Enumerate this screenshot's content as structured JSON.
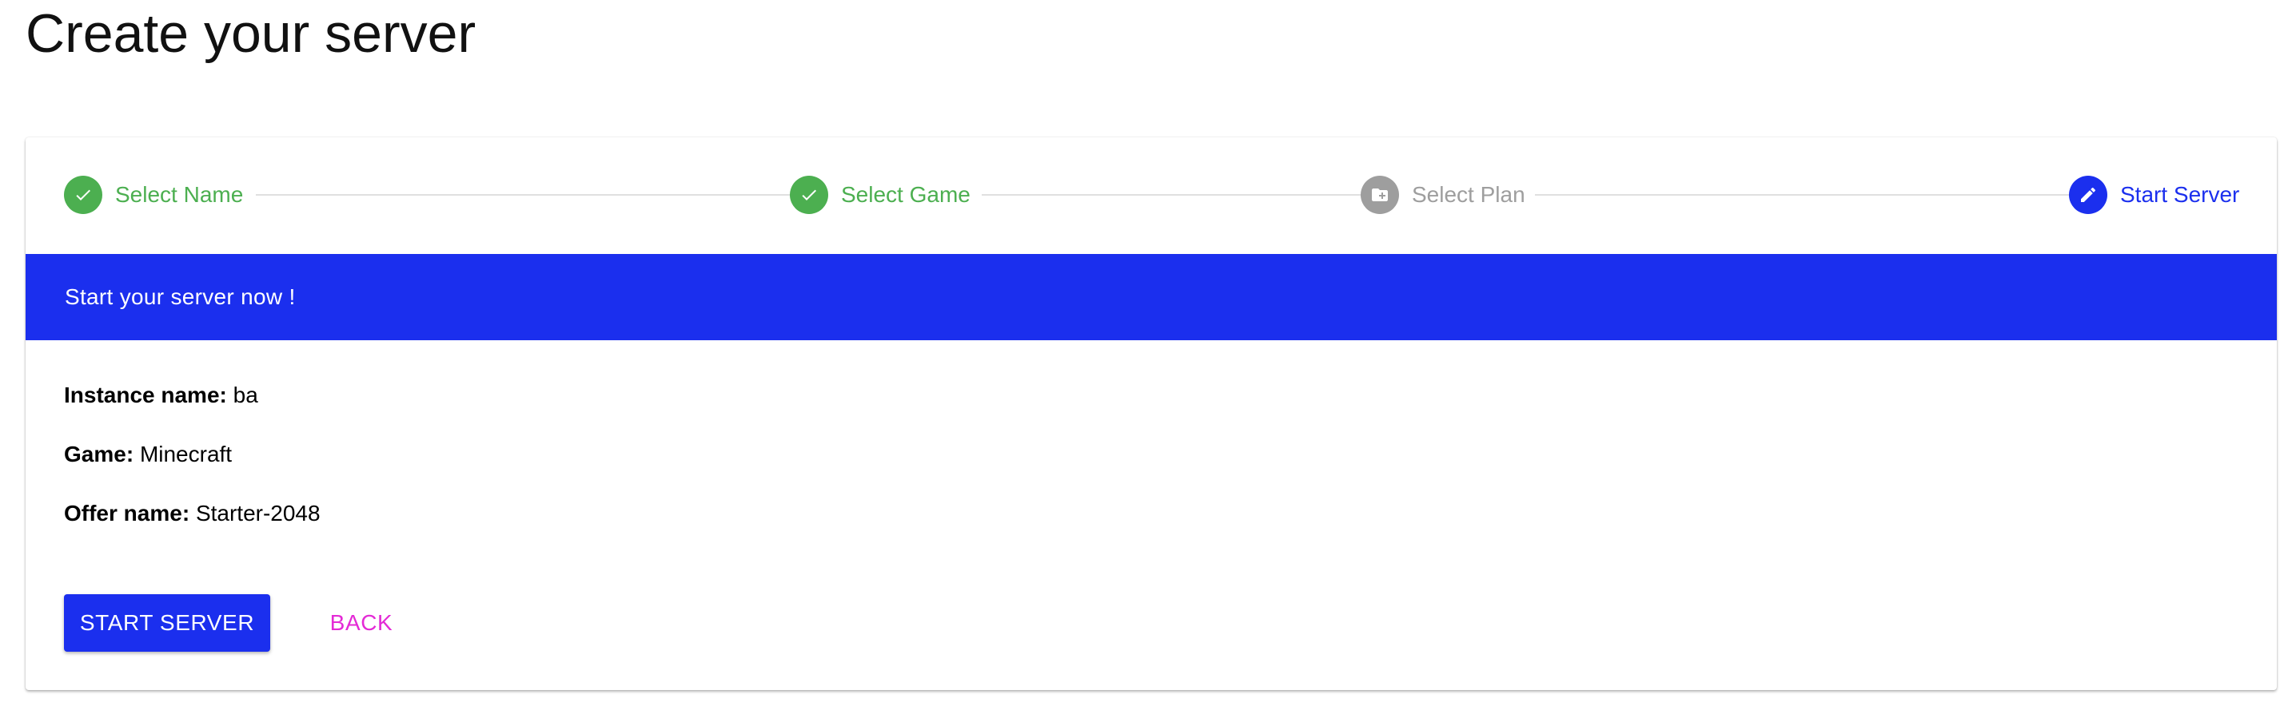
{
  "page": {
    "title": "Create your server"
  },
  "stepper": {
    "steps": [
      {
        "label": "Select Name",
        "state": "completed",
        "icon": "check-icon"
      },
      {
        "label": "Select Game",
        "state": "completed",
        "icon": "check-icon"
      },
      {
        "label": "Select Plan",
        "state": "inactive",
        "icon": "plan-folder-icon"
      },
      {
        "label": "Start Server",
        "state": "active",
        "icon": "pencil-icon"
      }
    ]
  },
  "banner": {
    "text": "Start your server now !"
  },
  "summary": {
    "instance_label": "Instance name:",
    "instance_value": "ba",
    "game_label": "Game:",
    "game_value": "Minecraft",
    "offer_label": "Offer name:",
    "offer_value": "Starter-2048"
  },
  "actions": {
    "start_label": "START SERVER",
    "back_label": "BACK"
  },
  "colors": {
    "primary": "#1b2fee",
    "completed": "#4caf50",
    "inactive": "#9e9e9e",
    "secondary": "#e42ad6"
  }
}
